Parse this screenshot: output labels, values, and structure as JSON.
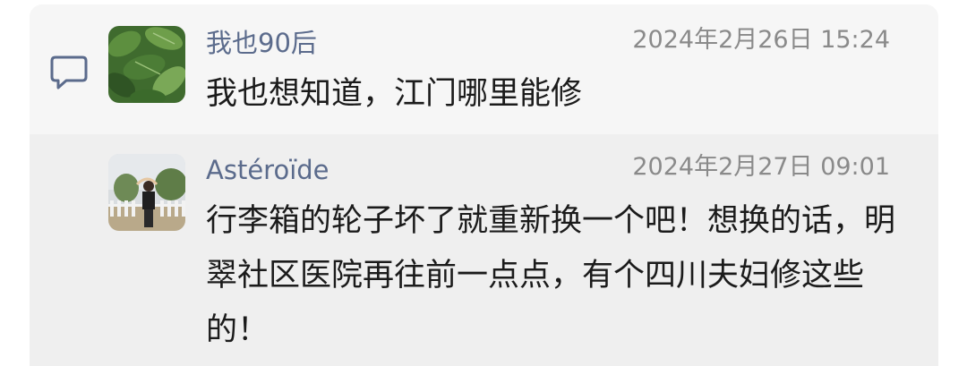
{
  "comment": {
    "username": "我也90后",
    "timestamp": "2024年2月26日 15:24",
    "content": "我也想知道，江门哪里能修",
    "icon": "comment-icon"
  },
  "reply": {
    "username": "Astéroïde",
    "timestamp": "2024年2月27日 09:01",
    "content": "行李箱的轮子坏了就重新换一个吧！想换的话，明翠社区医院再往前一点点，有个四川夫妇修这些的！"
  },
  "colors": {
    "username": "#5b6b8c",
    "timestamp": "#8a8a8a",
    "text": "#1b1b1b",
    "panel": "#f6f6f6",
    "reply_panel": "#efefef"
  }
}
